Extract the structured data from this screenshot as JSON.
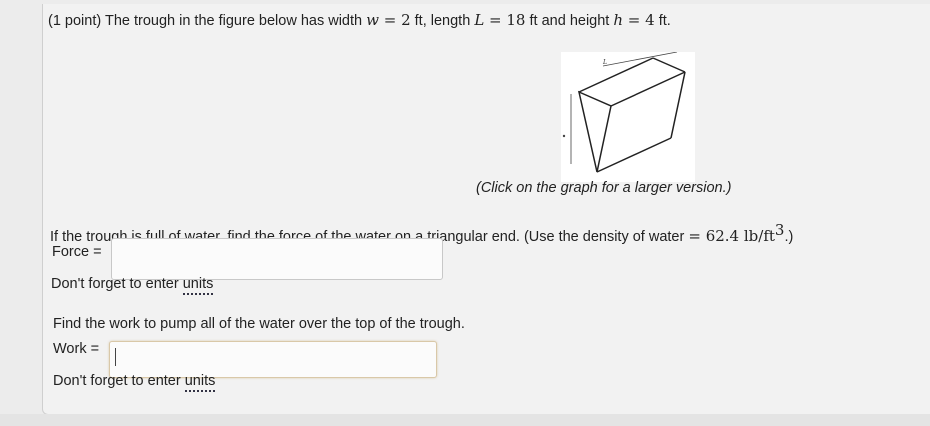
{
  "problem": {
    "intro": "(1 point) The trough in the figure below has width",
    "w_sym": "w",
    "eq1": " = ",
    "w_val": "2",
    "after_w": " ft, length ",
    "L_sym": "L",
    "eq2": " = ",
    "L_val": "18",
    "after_L": " ft and height ",
    "h_sym": "h",
    "eq3": " = ",
    "h_val": "4",
    "after_h": " ft."
  },
  "figure": {
    "length_label": "L",
    "caption": "(Click on the graph for a larger version.)"
  },
  "part1": {
    "question": "If the trough is full of water, find the force of the water on a triangular end. (Use the density of water ",
    "eq": " = ",
    "density": "62.4 lb/ft",
    "exp": "3",
    "close": ".)",
    "label": "Force =",
    "value": "",
    "units_prefix": "Don't forget to enter ",
    "units_link": "units"
  },
  "part2": {
    "question": "Find the work to pump all of the water over the top of the trough.",
    "label": "Work =",
    "value": "",
    "units_prefix": "Don't forget to enter ",
    "units_link": "units"
  }
}
